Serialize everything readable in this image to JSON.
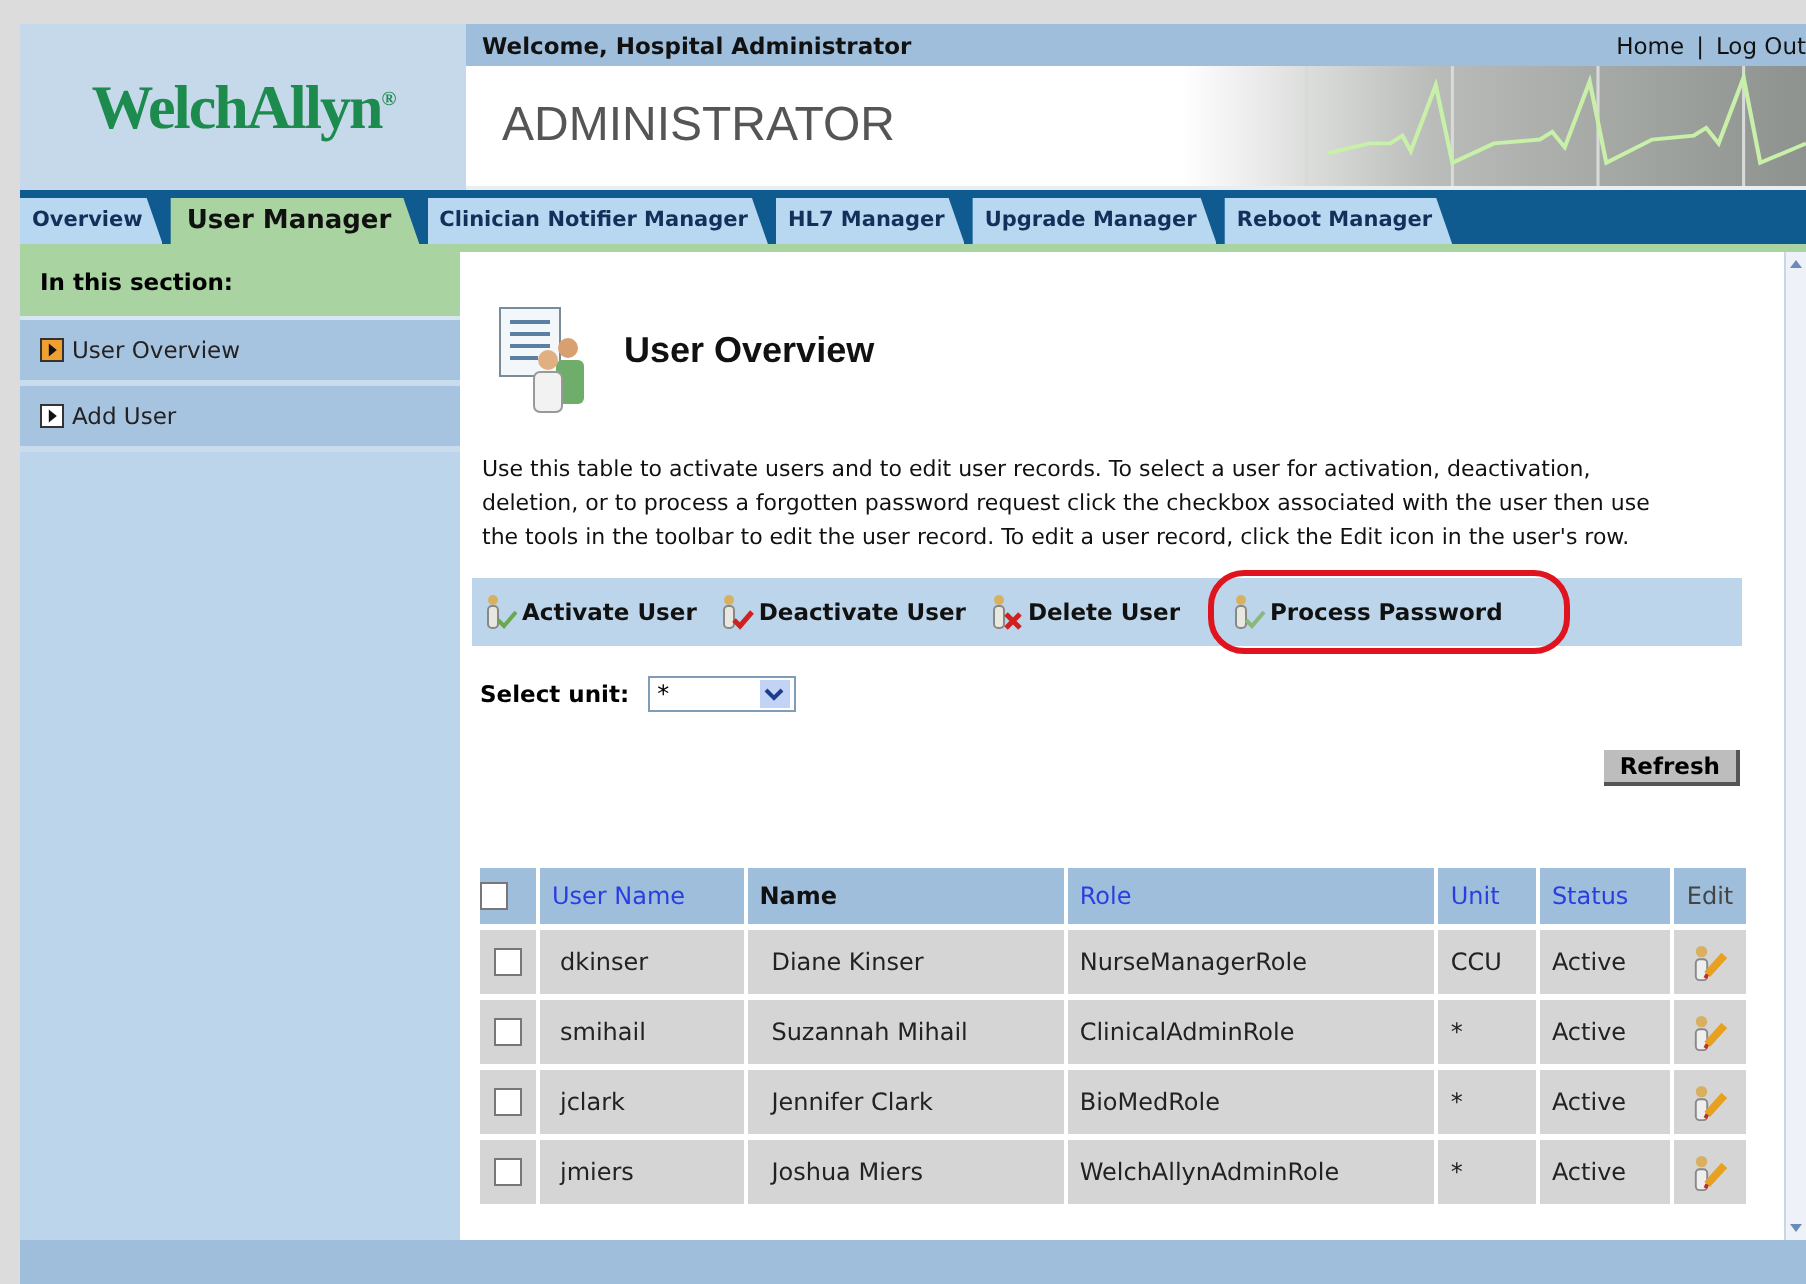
{
  "header": {
    "logo": "WelchAllyn$^{®}$",
    "welcome": "Welcome, Hospital Administrator",
    "links": [
      "Home",
      "|",
      "Log Out"
    ],
    "app_title": "ADMINISTRATOR"
  },
  "tabs": [
    {
      "label": "Overview",
      "selected": false
    },
    {
      "label": "User Manager",
      "selected": true
    },
    {
      "label": "Clinician Notifier Manager",
      "selected": false
    },
    {
      "label": "HL7 Manager",
      "selected": false
    },
    {
      "label": "Upgrade Manager",
      "selected": false
    },
    {
      "label": "Reboot Manager",
      "selected": false
    }
  ],
  "sidebar": {
    "heading": "In this section:",
    "items": [
      {
        "label": "User Overview",
        "selected": true
      },
      {
        "label": "Add User",
        "selected": false
      }
    ]
  },
  "page": {
    "title": "User Overview",
    "description": "Use this table to activate users and to edit user records. To select a user for activation, deactivation, deletion, or to process a forgotten password request click the checkbox associated with the user then use the tools in the toolbar to edit the user record. To edit a user record, click the Edit icon in the user's row."
  },
  "toolbar": [
    {
      "label": "Activate User",
      "kind": "activate",
      "highlighted": false
    },
    {
      "label": "Deactivate User",
      "kind": "deactivate",
      "highlighted": false
    },
    {
      "label": "Delete User",
      "kind": "delete",
      "highlighted": false
    },
    {
      "label": "Process Password",
      "kind": "password",
      "highlighted": true
    }
  ],
  "unit_filter": {
    "label": "Select unit:",
    "value": "*"
  },
  "refresh_button": "Refresh",
  "table": {
    "select_all": false,
    "columns": [
      {
        "label": "User Name",
        "kind": "link"
      },
      {
        "label": "Name",
        "kind": "sorted"
      },
      {
        "label": "Role",
        "kind": "link"
      },
      {
        "label": "Unit",
        "kind": "link"
      },
      {
        "label": "Status",
        "kind": "link"
      },
      {
        "label": "Edit",
        "kind": "plain"
      }
    ],
    "rows": [
      {
        "checked": false,
        "cells": [
          "dkinser",
          "Diane Kinser",
          "NurseManagerRole",
          "CCU",
          "Active"
        ]
      },
      {
        "checked": false,
        "cells": [
          "smihail",
          "Suzannah Mihail",
          "ClinicalAdminRole",
          "*",
          "Active"
        ]
      },
      {
        "checked": false,
        "cells": [
          "jclark",
          "Jennifer Clark",
          "BioMedRole",
          "*",
          "Active"
        ]
      },
      {
        "checked": false,
        "cells": [
          "jmiers",
          "Joshua Miers",
          "WelchAllynAdminRole",
          "*",
          "Active"
        ]
      }
    ]
  }
}
